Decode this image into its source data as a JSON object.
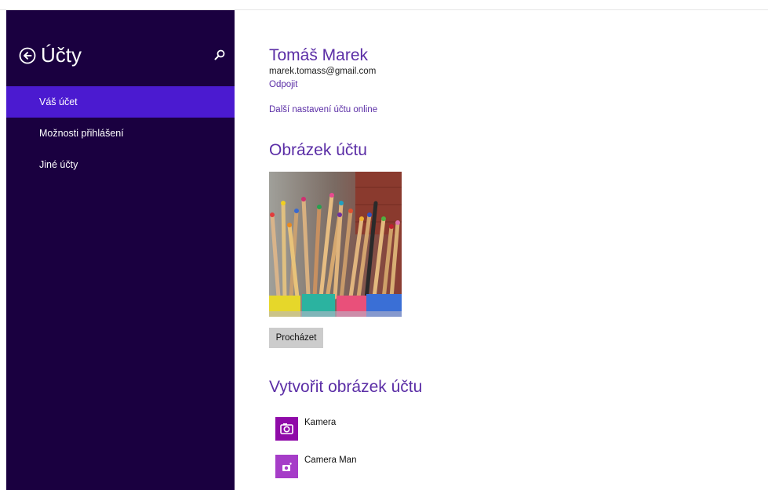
{
  "sidebar": {
    "title": "Účty",
    "items": [
      {
        "label": "Váš účet",
        "active": true
      },
      {
        "label": "Možnosti přihlášení",
        "active": false
      },
      {
        "label": "Jiné účty",
        "active": false
      }
    ],
    "back_icon": "back-arrow-circle-icon",
    "search_icon": "search-icon"
  },
  "account": {
    "name": "Tomáš Marek",
    "email": "marek.tomass@gmail.com",
    "disconnect_label": "Odpojit",
    "more_settings_label": "Další nastavení účtu online"
  },
  "picture_section": {
    "heading": "Obrázek účtu",
    "browse_label": "Procházet"
  },
  "create_section": {
    "heading": "Vytvořit obrázek účtu",
    "apps": [
      {
        "label": "Kamera",
        "icon": "camera-icon",
        "color": "#8f0aa8"
      },
      {
        "label": "Camera Man",
        "icon": "camera-icon",
        "color": "#a63dc8"
      }
    ]
  },
  "colors": {
    "sidebar_bg": "#1a0040",
    "sidebar_active": "#4b1ad0",
    "accent_text": "#5b2ea6"
  }
}
